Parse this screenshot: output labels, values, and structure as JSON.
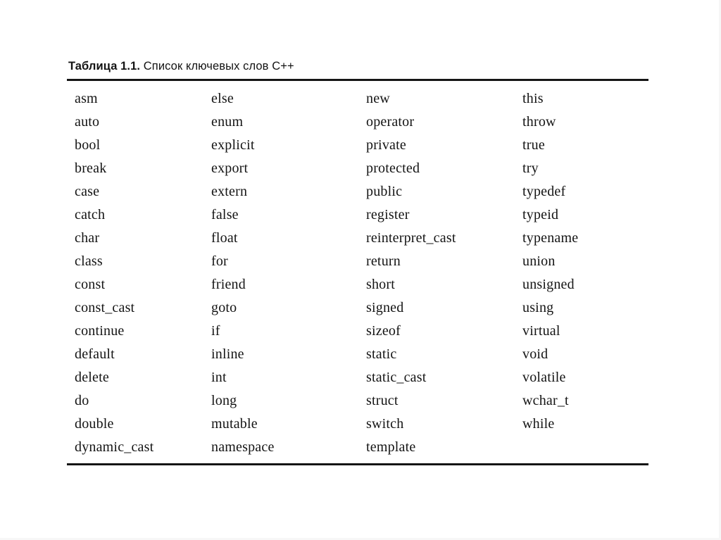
{
  "document": {
    "caption_label": "Таблица 1.1.",
    "caption_text": "Список ключевых слов C++",
    "rule_color": "#151515",
    "text_color": "#141414",
    "background": "#ffffff"
  },
  "table": {
    "column_count": 4,
    "row_count": 16,
    "columns": [
      {
        "index": 1,
        "cells": [
          "asm",
          "auto",
          "bool",
          "break",
          "case",
          "catch",
          "char",
          "class",
          "const",
          "const_cast",
          "continue",
          "default",
          "delete",
          "do",
          "double",
          "dynamic_cast"
        ]
      },
      {
        "index": 2,
        "cells": [
          "else",
          "enum",
          "explicit",
          "export",
          "extern",
          "false",
          "float",
          "for",
          "friend",
          "goto",
          "if",
          "inline",
          "int",
          "long",
          "mutable",
          "namespace"
        ]
      },
      {
        "index": 3,
        "cells": [
          "new",
          "operator",
          "private",
          "protected",
          "public",
          "register",
          "reinterpret_cast",
          "return",
          "short",
          "signed",
          "sizeof",
          "static",
          "static_cast",
          "struct",
          "switch",
          "template"
        ]
      },
      {
        "index": 4,
        "cells": [
          "this",
          "throw",
          "true",
          "try",
          "typedef",
          "typeid",
          "typename",
          "union",
          "unsigned",
          "using",
          "virtual",
          "void",
          "volatile",
          "wchar_t",
          "while",
          ""
        ]
      }
    ]
  }
}
